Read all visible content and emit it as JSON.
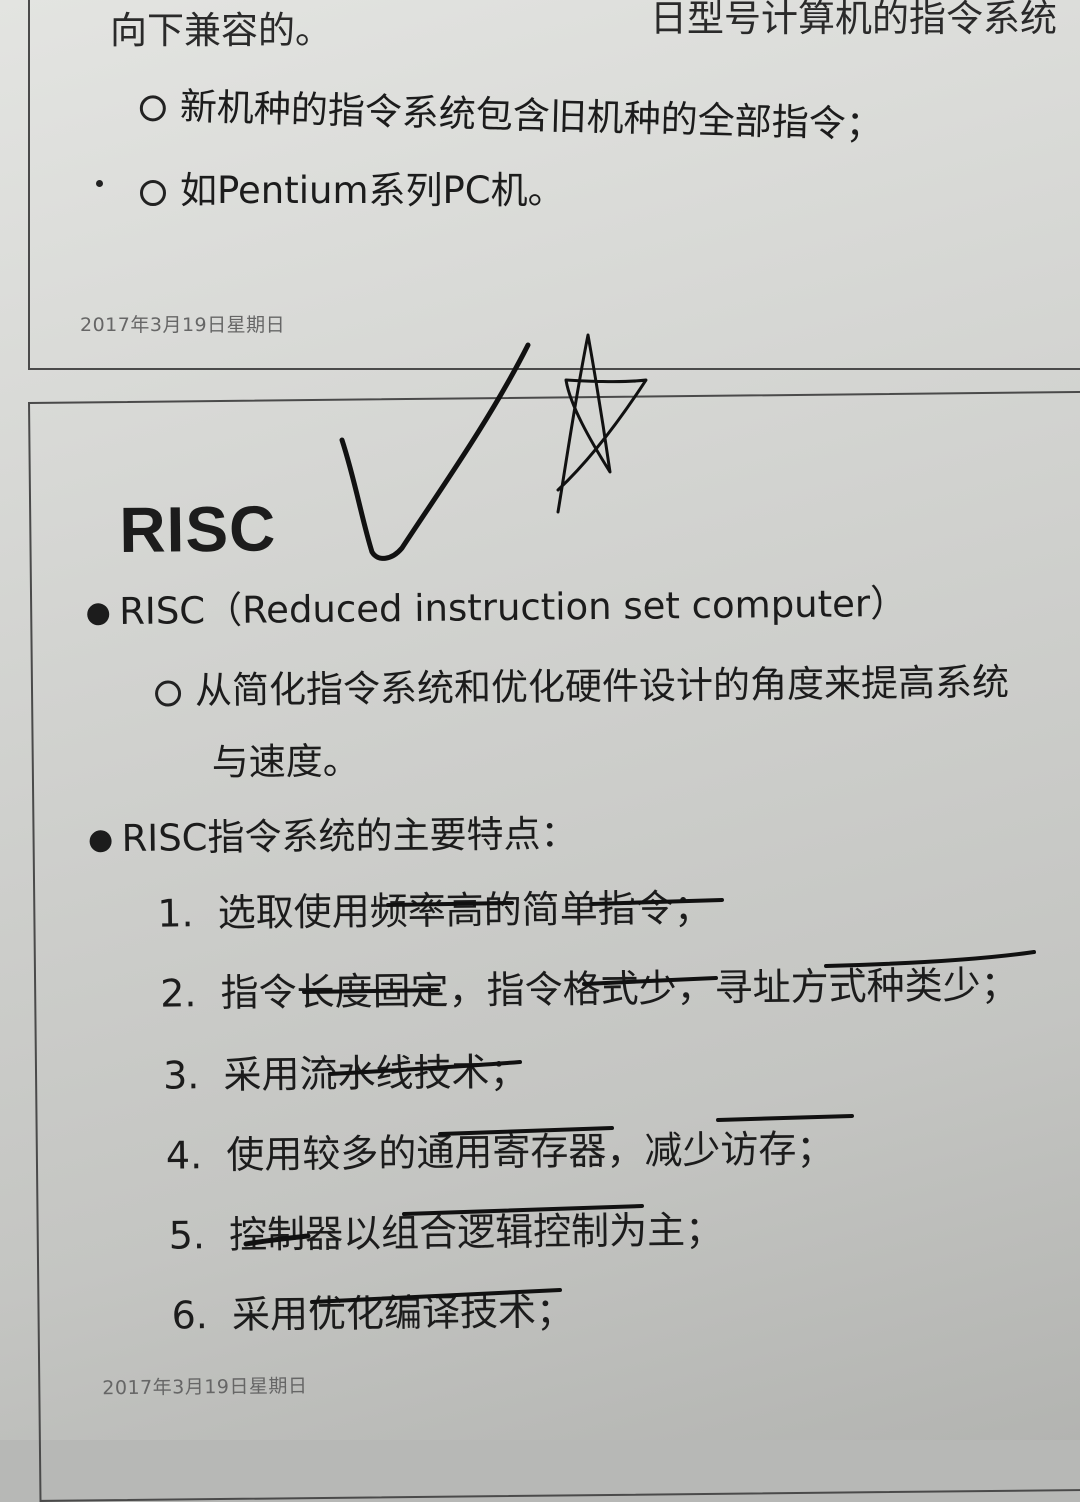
{
  "slide_top": {
    "partial_header_left": "向下兼容的。",
    "partial_header_right": "日型号计算机的指令系统",
    "items": [
      "新机种的指令系统包含旧机种的全部指令；",
      "如Pentium系列PC机。"
    ],
    "footer_date": "2017年3月19日星期日"
  },
  "slide_bottom": {
    "title": "RISC",
    "bullet1": "RISC（Reduced instruction set computer）",
    "bullet1_sub_line1": "从简化指令系统和优化硬件设计的角度来提高系统",
    "bullet1_sub_line2": "与速度。",
    "bullet2": "RISC指令系统的主要特点：",
    "features": [
      {
        "num": "1.",
        "text": "选取使用频率高的简单指令；"
      },
      {
        "num": "2.",
        "text": "指令长度固定，指令格式少，寻址方式种类少；"
      },
      {
        "num": "3.",
        "text": "采用流水线技术；"
      },
      {
        "num": "4.",
        "text": "使用较多的通用寄存器，减少访存；"
      },
      {
        "num": "5.",
        "text": "控制器以组合逻辑控制为主；"
      },
      {
        "num": "6.",
        "text": "采用优化编译技术；"
      }
    ],
    "footer_date": "2017年3月19日星期日"
  },
  "colors": {
    "paper": "#d6d7d4",
    "ink": "#1c1c1c",
    "border": "#4a4a4a"
  }
}
